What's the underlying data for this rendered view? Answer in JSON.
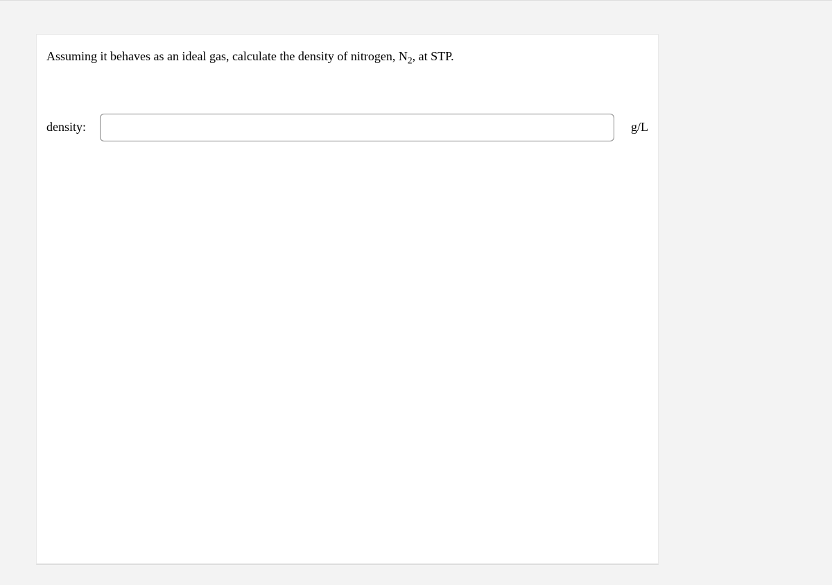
{
  "question": {
    "prefix": "Assuming it behaves as an ideal gas, calculate the density of nitrogen, N",
    "subscript": "2",
    "suffix": ", at STP."
  },
  "answer": {
    "label": "density:",
    "value": "",
    "unit": "g/L"
  }
}
